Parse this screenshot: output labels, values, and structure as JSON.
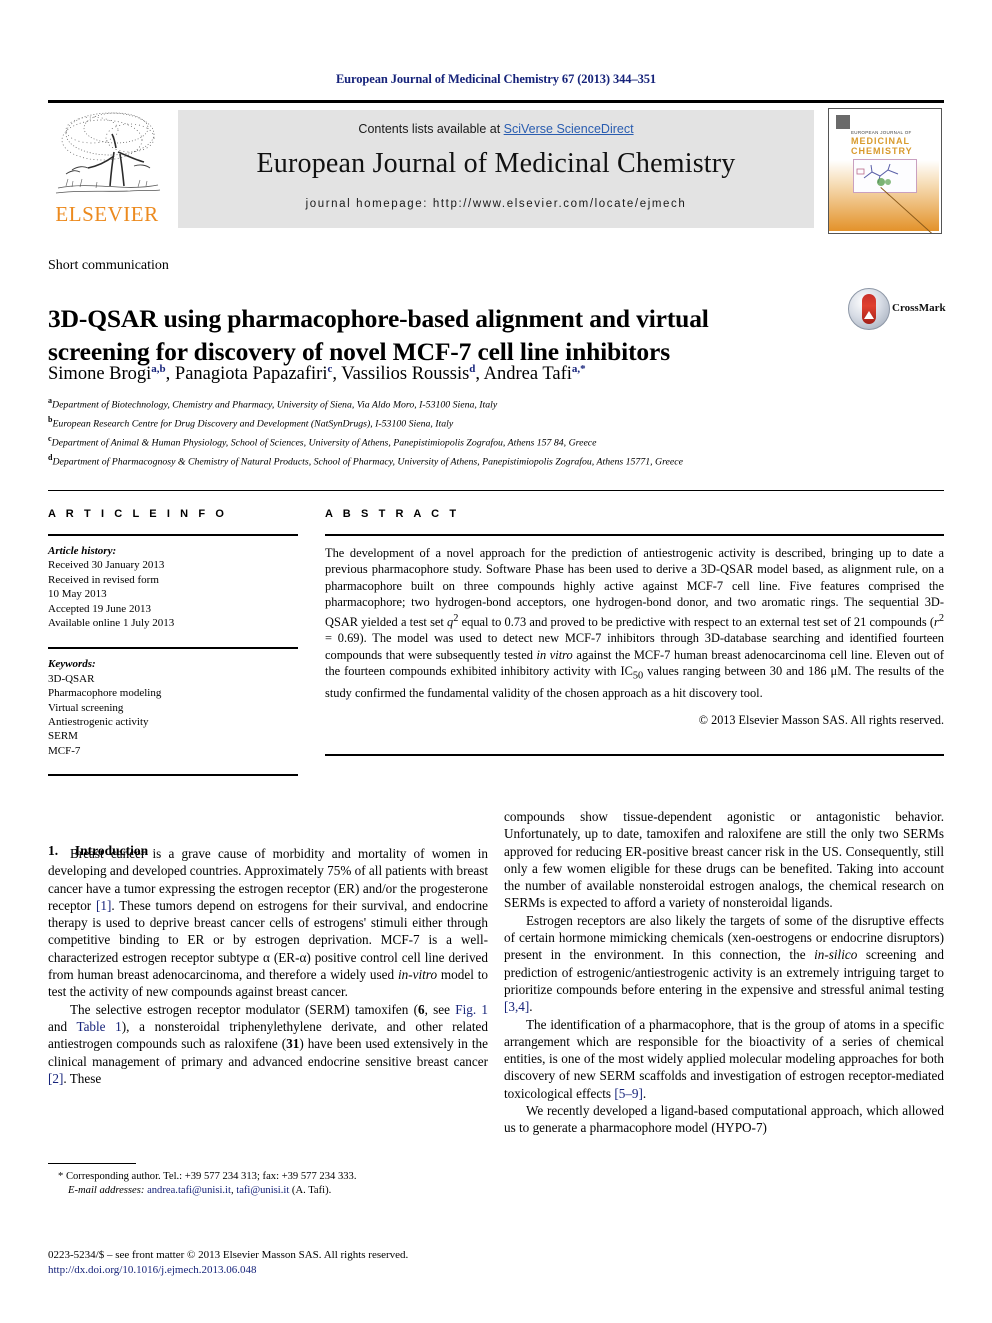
{
  "running_head": "European Journal of Medicinal Chemistry 67 (2013) 344–351",
  "masthead": {
    "contents_prefix": "Contents lists available at ",
    "contents_link": "SciVerse ScienceDirect",
    "journal_title": "European Journal of Medicinal Chemistry",
    "homepage": "journal homepage: http://www.elsevier.com/locate/ejmech",
    "publisher_logo_text": "ELSEVIER",
    "cover": {
      "society_line": "EUROPEAN JOURNAL OF",
      "title_line1": "MEDICINAL",
      "title_line2": "CHEMISTRY"
    }
  },
  "article": {
    "type": "Short communication",
    "title": "3D-QSAR using pharmacophore-based alignment and virtual screening for discovery of novel MCF-7 cell line inhibitors",
    "crossmark_label": "CrossMark",
    "authors_html": "Simone Brogi<sup>a,b</sup>, Panagiota Papazafiri<sup>c</sup>, Vassilios Roussis<sup>d</sup>, Andrea Tafi<sup>a,*</sup>",
    "affiliations": [
      {
        "mark": "a",
        "text": "Department of Biotechnology, Chemistry and Pharmacy, University of Siena, Via Aldo Moro, I-53100 Siena, Italy"
      },
      {
        "mark": "b",
        "text": "European Research Centre for Drug Discovery and Development (NatSynDrugs), I-53100 Siena, Italy"
      },
      {
        "mark": "c",
        "text": "Department of Animal & Human Physiology, School of Sciences, University of Athens, Panepistimiopolis Zografou, Athens 157 84, Greece"
      },
      {
        "mark": "d",
        "text": "Department of Pharmacognosy & Chemistry of Natural Products, School of Pharmacy, University of Athens, Panepistimiopolis Zografou, Athens 15771, Greece"
      }
    ]
  },
  "article_info": {
    "heading": "A R T I C L E  I N F O",
    "history_label": "Article history:",
    "history": [
      "Received 30 January 2013",
      "Received in revised form",
      "10 May 2013",
      "Accepted 19 June 2013",
      "Available online 1 July 2013"
    ],
    "keywords_label": "Keywords:",
    "keywords": [
      "3D-QSAR",
      "Pharmacophore modeling",
      "Virtual screening",
      "Antiestrogenic activity",
      "SERM",
      "MCF-7"
    ]
  },
  "abstract": {
    "heading": "A B S T R A C T",
    "body_html": "The development of a novel approach for the prediction of antiestrogenic activity is described, bringing up to date a previous pharmacophore study. Software Phase has been used to derive a 3D-QSAR model based, as alignment rule, on a pharmacophore built on three compounds highly active against MCF-7 cell line. Five features comprised the pharmacophore; two hydrogen-bond acceptors, one hydrogen-bond donor, and two aromatic rings. The sequential 3D-QSAR yielded a test set <i>q</i><sup>2</sup> equal to 0.73 and proved to be predictive with respect to an external test set of 21 compounds (<i>r</i><sup>2</sup> = 0.69). The model was used to detect new MCF-7 inhibitors through 3D-database searching and identified fourteen compounds that were subsequently tested <i>in vitro</i> against the MCF-7 human breast adenocarcinoma cell line. Eleven out of the fourteen compounds exhibited inhibitory activity with IC<sub>50</sub> values ranging between 30 and 186 μM. The results of the study confirmed the fundamental validity of the chosen approach as a hit discovery tool.",
    "copyright": "© 2013 Elsevier Masson SAS. All rights reserved."
  },
  "body": {
    "section1_number": "1.",
    "section1_title": "Introduction",
    "left_paragraphs_html": [
      "Breast cancer is a grave cause of morbidity and mortality of women in developing and developed countries. Approximately 75% of all patients with breast cancer have a tumor expressing the estrogen receptor (ER) and/or the progesterone receptor <span class=\"ref\">[1]</span>. These tumors depend on estrogens for their survival, and endocrine therapy is used to deprive breast cancer cells of estrogens' stimuli either through competitive binding to ER or by estrogen deprivation. MCF-7 is a well-characterized estrogen receptor subtype α (ER-α) positive control cell line derived from human breast adenocarcinoma, and therefore a widely used <i>in-vitro</i> model to test the activity of new compounds against breast cancer.",
      "The selective estrogen receptor modulator (SERM) tamoxifen (<b>6</b>, see <span class=\"ref\">Fig. 1</span> and <span class=\"ref\">Table 1</span>), a nonsteroidal triphenylethylene derivate, and other related antiestrogen compounds such as raloxifene (<b>31</b>) have been used extensively in the clinical management of primary and advanced endocrine sensitive breast cancer <span class=\"ref\">[2]</span>. These"
    ],
    "right_paragraphs_html": [
      "compounds show tissue-dependent agonistic or antagonistic behavior. Unfortunately, up to date, tamoxifen and raloxifene are still the only two SERMs approved for reducing ER-positive breast cancer risk in the US. Consequently, still only a few women eligible for these drugs can be benefited. Taking into account the number of available nonsteroidal estrogen analogs, the chemical research on SERMs is expected to afford a variety of nonsteroidal ligands.",
      "Estrogen receptors are also likely the targets of some of the disruptive effects of certain hormone mimicking chemicals (xen-oestrogens or endocrine disruptors) present in the environment. In this connection, the <i>in-silico</i> screening and prediction of estrogenic/antiestrogenic activity is an extremely intriguing target to prioritize compounds before entering in the expensive and stressful animal testing <span class=\"ref\">[3,4]</span>.",
      "The identification of a pharmacophore, that is the group of atoms in a specific arrangement which are responsible for the bioactivity of a series of chemical entities, is one of the most widely applied molecular modeling approaches for both discovery of new SERM scaffolds and investigation of estrogen receptor-mediated toxicological effects <span class=\"ref\">[5–9]</span>.",
      "We recently developed a ligand-based computational approach, which allowed us to generate a pharmacophore model (HYPO-7)"
    ]
  },
  "footnote": {
    "corresponding_html": "* Corresponding author. Tel.: +39 577 234 313; fax: +39 577 234 333.",
    "email_html": "<span class=\"em\">E-mail addresses:</span> <span class=\"lnk\">andrea.tafi@unisi.it</span>, <span class=\"lnk\">tafi@unisi.it</span> (A. Tafi)."
  },
  "imprint": {
    "line1": "0223-5234/$ – see front matter © 2013 Elsevier Masson SAS. All rights reserved.",
    "doi": "http://dx.doi.org/10.1016/j.ejmech.2013.06.048"
  },
  "colors": {
    "link_blue": "#16237a",
    "sciencedirect_blue": "#2a5db0",
    "elsevier_orange": "#ec8a1e",
    "band_grey": "#e3e3e3"
  }
}
